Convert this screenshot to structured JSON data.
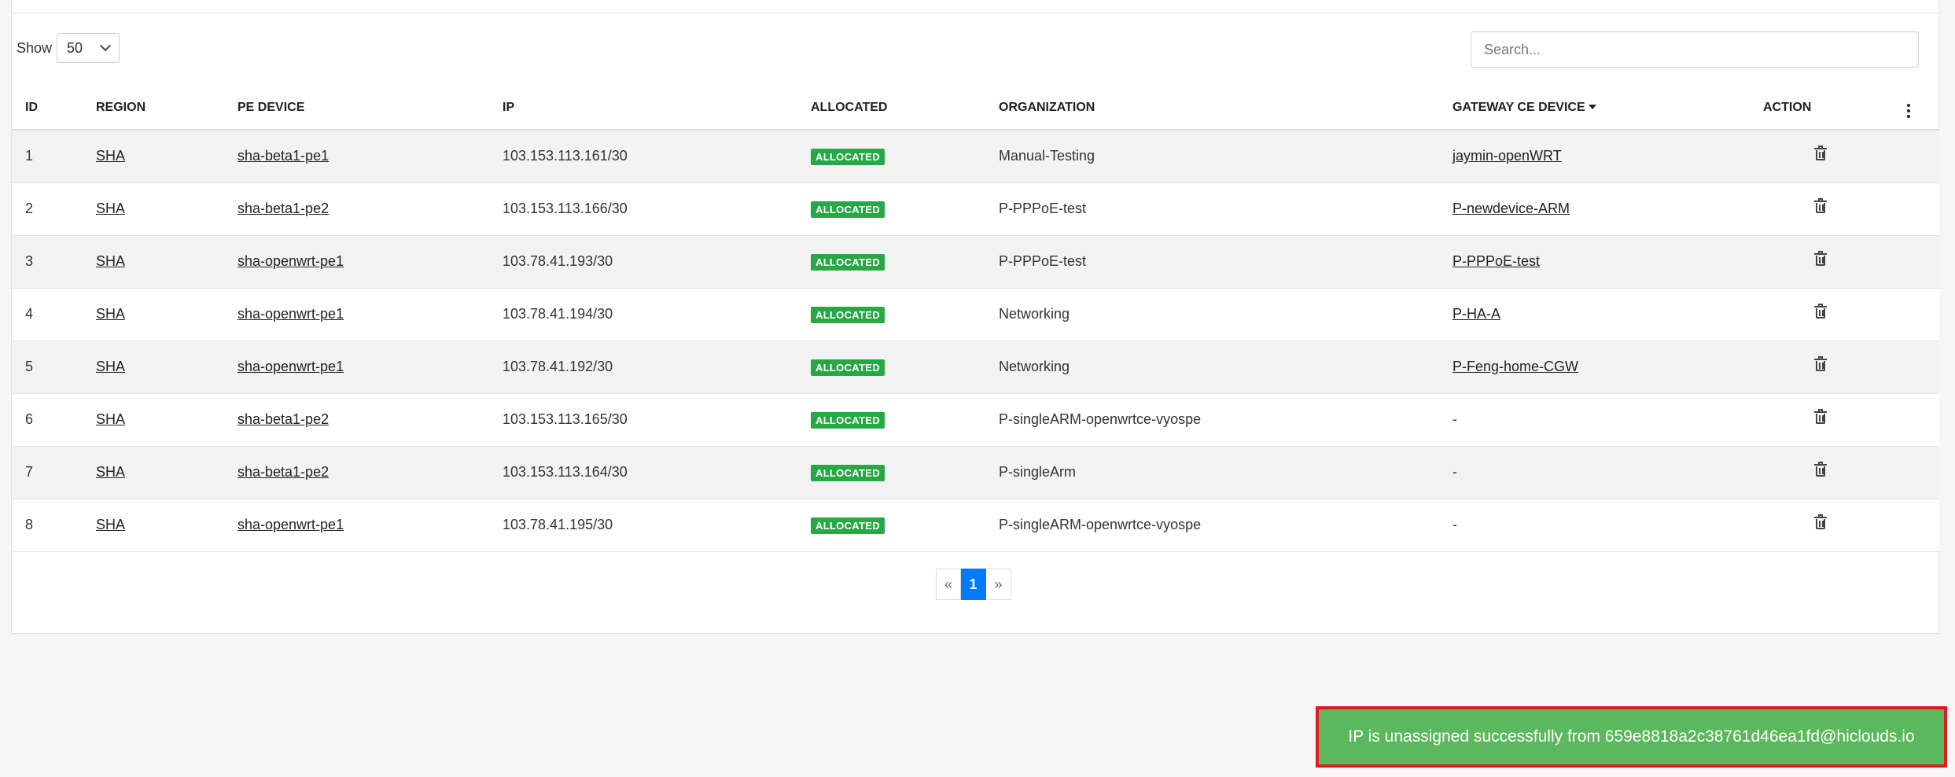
{
  "controls": {
    "show_label": "Show",
    "page_size": "50",
    "search_placeholder": "Search..."
  },
  "table": {
    "columns": {
      "id": "ID",
      "region": "REGION",
      "pe_device": "PE DEVICE",
      "ip": "IP",
      "allocated": "ALLOCATED",
      "organization": "ORGANIZATION",
      "gateway": "GATEWAY CE DEVICE",
      "action": "ACTION"
    },
    "rows": [
      {
        "id": "1",
        "region": "SHA",
        "pe_device": "sha-beta1-pe1",
        "ip": "103.153.113.161/30",
        "status": "ALLOCATED",
        "organization": "Manual-Testing",
        "gateway": "jaymin-openWRT"
      },
      {
        "id": "2",
        "region": "SHA",
        "pe_device": "sha-beta1-pe2",
        "ip": "103.153.113.166/30",
        "status": "ALLOCATED",
        "organization": "P-PPPoE-test",
        "gateway": "P-newdevice-ARM"
      },
      {
        "id": "3",
        "region": "SHA",
        "pe_device": "sha-openwrt-pe1",
        "ip": "103.78.41.193/30",
        "status": "ALLOCATED",
        "organization": "P-PPPoE-test",
        "gateway": "P-PPPoE-test"
      },
      {
        "id": "4",
        "region": "SHA",
        "pe_device": "sha-openwrt-pe1",
        "ip": "103.78.41.194/30",
        "status": "ALLOCATED",
        "organization": "Networking",
        "gateway": "P-HA-A"
      },
      {
        "id": "5",
        "region": "SHA",
        "pe_device": "sha-openwrt-pe1",
        "ip": "103.78.41.192/30",
        "status": "ALLOCATED",
        "organization": "Networking",
        "gateway": "P-Feng-home-CGW"
      },
      {
        "id": "6",
        "region": "SHA",
        "pe_device": "sha-beta1-pe2",
        "ip": "103.153.113.165/30",
        "status": "ALLOCATED",
        "organization": "P-singleARM-openwrtce-vyospe",
        "gateway": "-"
      },
      {
        "id": "7",
        "region": "SHA",
        "pe_device": "sha-beta1-pe2",
        "ip": "103.153.113.164/30",
        "status": "ALLOCATED",
        "organization": "P-singleArm",
        "gateway": "-"
      },
      {
        "id": "8",
        "region": "SHA",
        "pe_device": "sha-openwrt-pe1",
        "ip": "103.78.41.195/30",
        "status": "ALLOCATED",
        "organization": "P-singleARM-openwrtce-vyospe",
        "gateway": "-"
      }
    ]
  },
  "pagination": {
    "prev": "«",
    "current": "1",
    "next": "»"
  },
  "toast": {
    "message": "IP is unassigned successfully from 659e8818a2c38761d46ea1fd@hiclouds.io"
  },
  "colors": {
    "badge": "#28a745",
    "toast": "#5cb85c",
    "toast_border": "#e01b24",
    "pager_active": "#007bff"
  }
}
